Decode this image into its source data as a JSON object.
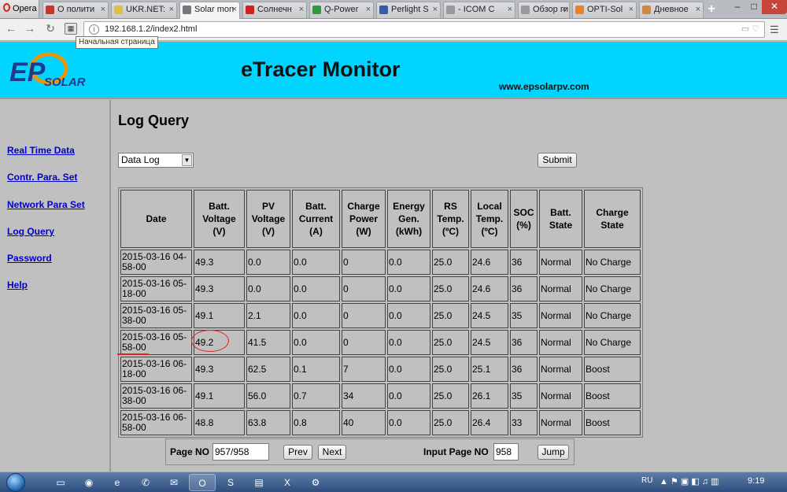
{
  "browser": {
    "menu_label": "Opera",
    "tabs": [
      {
        "label": "О полити",
        "color": "#c0392b"
      },
      {
        "label": "UKR.NET:",
        "color": "#e0c040"
      },
      {
        "label": "Solar mon",
        "color": "#777777"
      },
      {
        "label": "Солнечн",
        "color": "#d42020"
      },
      {
        "label": "Q-Power",
        "color": "#2a9d3a"
      },
      {
        "label": "Perlight S",
        "color": "#3a5aa8"
      },
      {
        "label": "- ICOM C",
        "color": "#999999"
      },
      {
        "label": "Обзор ги",
        "color": "#999999"
      },
      {
        "label": "OPTI-Sol",
        "color": "#f08020"
      },
      {
        "label": "Дневное",
        "color": "#cc8844"
      }
    ],
    "newtab_label": "+",
    "window_buttons": {
      "minimize": "–",
      "maximize": "□",
      "close": "✕"
    },
    "url": "192.168.1.2/index2.html",
    "tooltip": "Начальная страница"
  },
  "header": {
    "title": "eTracer Monitor",
    "website": "www.epsolarpv.com",
    "logo_text": "EP",
    "logo_sub": "SOLAR"
  },
  "sidebar": {
    "items": [
      {
        "label": "Real Time Data"
      },
      {
        "label": "Contr. Para. Set"
      },
      {
        "label": "Network Para Set"
      },
      {
        "label": "Log Query"
      },
      {
        "label": "Password"
      },
      {
        "label": "Help "
      }
    ]
  },
  "main": {
    "title": "Log Query",
    "select_value": "Data Log",
    "submit_label": "Submit"
  },
  "table": {
    "headers": [
      "Date",
      "Batt.\nVoltage\n(V)",
      "PV\nVoltage\n(V)",
      "Batt.\nCurrent\n(A)",
      "Charge\nPower\n(W)",
      "Energy\nGen.\n(kWh)",
      "RS\nTemp.\n(ºC)",
      "Local\nTemp.\n(ºC)",
      "SOC\n(%)",
      "Batt.\nState",
      "Charge\nState"
    ],
    "rows": [
      [
        "2015-03-16 04-58-00",
        "49.3",
        "0.0",
        "0.0",
        "0",
        "0.0",
        "25.0",
        "24.6",
        "36",
        "Normal",
        "No Charge"
      ],
      [
        "2015-03-16 05-18-00",
        "49.3",
        "0.0",
        "0.0",
        "0",
        "0.0",
        "25.0",
        "24.6",
        "36",
        "Normal",
        "No Charge"
      ],
      [
        "2015-03-16 05-38-00",
        "49.1",
        "2.1",
        "0.0",
        "0",
        "0.0",
        "25.0",
        "24.5",
        "35",
        "Normal",
        "No Charge"
      ],
      [
        "2015-03-16 05-58-00",
        "49.2",
        "41.5",
        "0.0",
        "0",
        "0.0",
        "25.0",
        "24.5",
        "36",
        "Normal",
        "No Charge"
      ],
      [
        "2015-03-16 06-18-00",
        "49.3",
        "62.5",
        "0.1",
        "7",
        "0.0",
        "25.0",
        "25.1",
        "36",
        "Normal",
        "Boost"
      ],
      [
        "2015-03-16 06-38-00",
        "49.1",
        "56.0",
        "0.7",
        "34",
        "0.0",
        "25.0",
        "26.1",
        "35",
        "Normal",
        "Boost"
      ],
      [
        "2015-03-16 06-58-00",
        "48.8",
        "63.8",
        "0.8",
        "40",
        "0.0",
        "25.0",
        "26.4",
        "33",
        "Normal",
        "Boost"
      ]
    ]
  },
  "pager": {
    "page_label": "Page NO",
    "page_value": "957/958",
    "prev_label": "Prev",
    "next_label": "Next",
    "input_label": "Input Page NO",
    "input_value": "958",
    "jump_label": "Jump"
  },
  "taskbar": {
    "language": "RU",
    "clock": "9:19"
  }
}
